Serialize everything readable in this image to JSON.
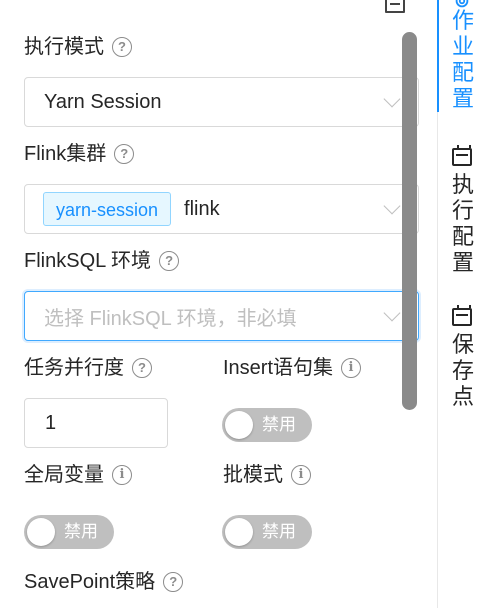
{
  "form": {
    "exec_mode": {
      "label": "执行模式",
      "value": "Yarn Session"
    },
    "flink_cluster": {
      "label": "Flink集群",
      "tag": "yarn-session",
      "value": "flink"
    },
    "flinksql_env": {
      "label": "FlinkSQL 环境",
      "placeholder": "选择 FlinkSQL 环境，非必填"
    },
    "parallelism": {
      "label": "任务并行度",
      "value": "1"
    },
    "insert_set": {
      "label": "Insert语句集",
      "switch": "禁用"
    },
    "global_vars": {
      "label": "全局变量",
      "switch": "禁用"
    },
    "batch_mode": {
      "label": "批模式",
      "switch": "禁用"
    },
    "savepoint": {
      "label": "SavePoint策略"
    }
  },
  "tabs": [
    {
      "label": "作业配置",
      "icon": "gear-icon",
      "active": true
    },
    {
      "label": "执行配置",
      "icon": "calendar-icon",
      "active": false
    },
    {
      "label": "保存点",
      "icon": "calendar-icon",
      "active": false
    }
  ],
  "colors": {
    "accent": "#1890ff",
    "switch_off": "#bfbfbf",
    "tag_bg": "#e6f7ff"
  }
}
